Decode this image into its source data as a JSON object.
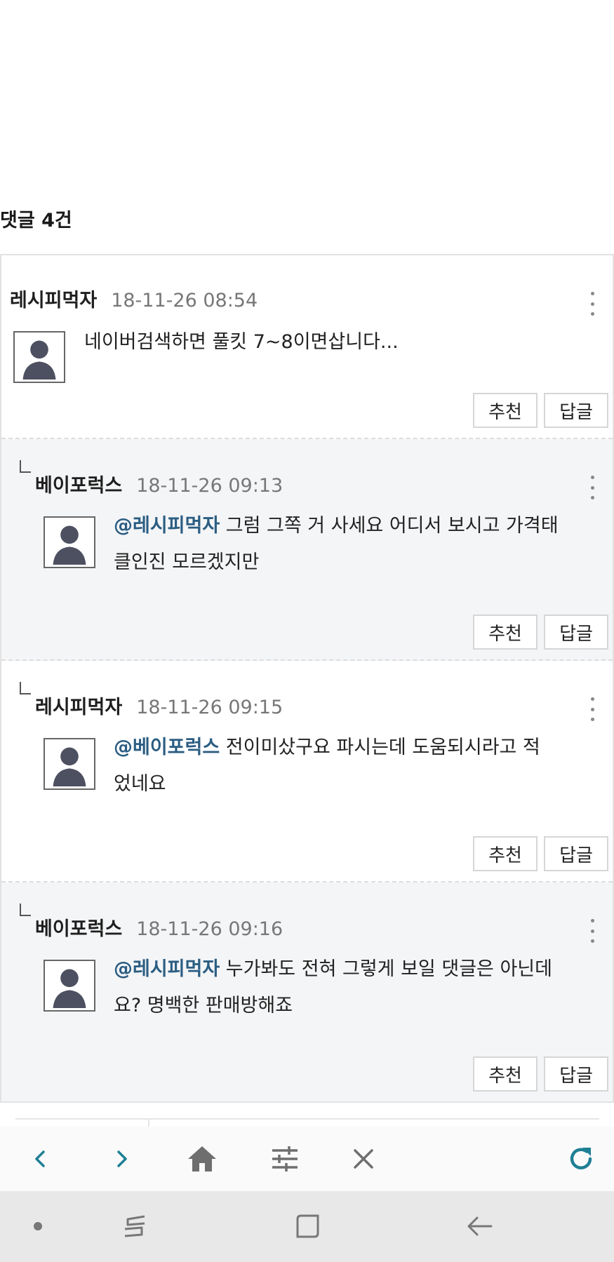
{
  "comments_header": {
    "label": "댓글",
    "count": "4건"
  },
  "comments": [
    {
      "author": "레시피먹자",
      "date": "18-11-26 08:54",
      "mention": "",
      "text": "네이버검색하면 풀킷 7~8이면삽니다...",
      "text_line2": "",
      "is_reply": false,
      "recommend_label": "추천",
      "reply_label": "답글"
    },
    {
      "author": "베이포럭스",
      "date": "18-11-26 09:13",
      "mention": "@레시피먹자",
      "text": " 그럼 그쪽 거 사세요 어디서 보시고 가격태",
      "text_line2": "클인진 모르겠지만",
      "is_reply": true,
      "recommend_label": "추천",
      "reply_label": "답글"
    },
    {
      "author": "레시피먹자",
      "date": "18-11-26 09:15",
      "mention": "@베이포럭스",
      "text": " 전이미샀구요 파시는데 도움되시라고 적",
      "text_line2": "었네요",
      "is_reply": true,
      "recommend_label": "추천",
      "reply_label": "답글"
    },
    {
      "author": "베이포럭스",
      "date": "18-11-26 09:16",
      "mention": "@레시피먹자",
      "text": " 누가봐도 전혀 그렇게 보일 댓글은 아닌데",
      "text_line2": "요? 명백한 판매방해죠",
      "is_reply": true,
      "recommend_label": "추천",
      "reply_label": "답글"
    }
  ],
  "browser_toolbar": {
    "icons": [
      "back-icon",
      "forward-icon",
      "home-icon",
      "tune-icon",
      "close-icon",
      "refresh-icon"
    ],
    "accent_color": "#1e7f94",
    "icon_color": "#6e6e6e"
  },
  "system_nav": {
    "icons": [
      "dot-icon",
      "recent-apps-icon",
      "home-square-icon",
      "back-arrow-icon"
    ]
  }
}
